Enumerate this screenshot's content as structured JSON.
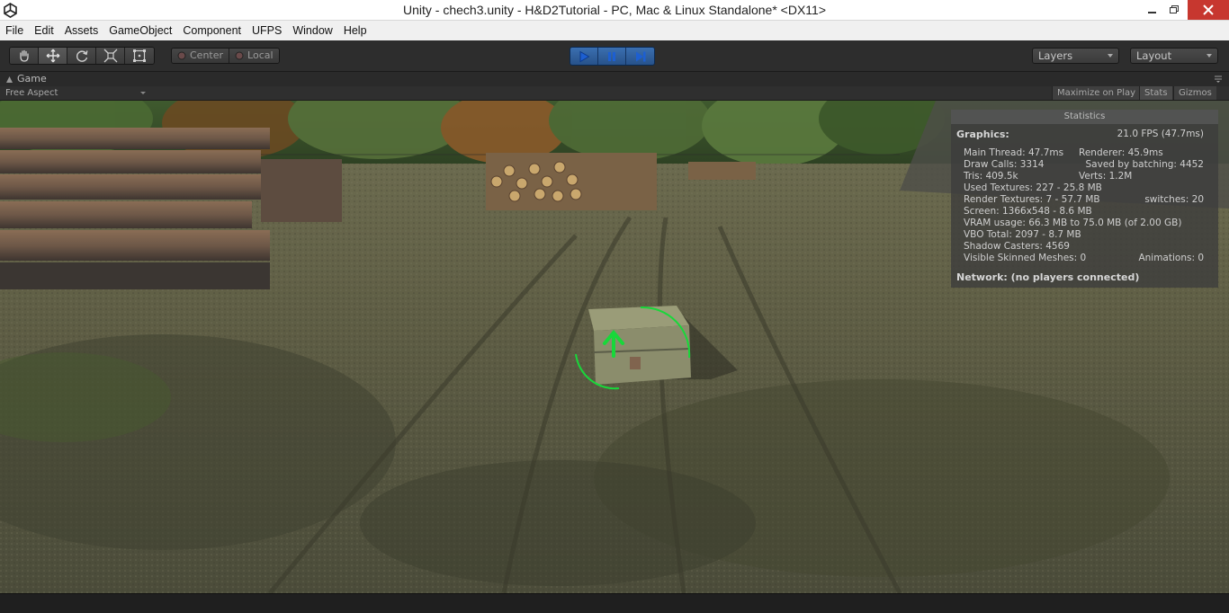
{
  "window": {
    "title": "Unity - chech3.unity - H&D2Tutorial - PC, Mac & Linux Standalone* <DX11>",
    "controls": [
      "minimize",
      "maximize",
      "close"
    ]
  },
  "menu": {
    "items": [
      "File",
      "Edit",
      "Assets",
      "GameObject",
      "Component",
      "UFPS",
      "Window",
      "Help"
    ]
  },
  "toolbar": {
    "transform_tools": [
      "hand-icon",
      "move-icon",
      "rotate-icon",
      "scale-icon",
      "rect-icon"
    ],
    "pivot_center": "Center",
    "pivot_local": "Local",
    "play_controls": [
      "play-icon",
      "pause-icon",
      "step-icon"
    ],
    "layers_label": "Layers",
    "layout_label": "Layout"
  },
  "game_tab": {
    "label": "Game",
    "aspect": "Free Aspect",
    "maximize_on_play": "Maximize on Play",
    "stats": "Stats",
    "gizmos": "Gizmos"
  },
  "statistics": {
    "header": "Statistics",
    "graphics_label": "Graphics:",
    "fps": "21.0 FPS (47.7ms)",
    "main_thread": "Main Thread: 47.7ms",
    "renderer": "Renderer: 45.9ms",
    "draw_calls": "Draw Calls: 3314",
    "saved_by_batching": "Saved by batching: 4452",
    "tris": "Tris: 409.5k",
    "verts": "Verts: 1.2M",
    "used_textures": "Used Textures: 227 - 25.8 MB",
    "render_textures": "Render Textures: 7 - 57.7 MB",
    "switches": "switches: 20",
    "screen": "Screen: 1366x548 - 8.6 MB",
    "vram_usage": "VRAM usage: 66.3 MB to 75.0 MB (of 2.00 GB)",
    "vbo_total": "VBO Total: 2097 - 8.7 MB",
    "shadow_casters": "Shadow Casters: 4569",
    "visible_skinned_meshes": "Visible Skinned Meshes: 0",
    "animations": "Animations: 0",
    "network": "Network: (no players connected)"
  },
  "colors": {
    "toolbar_bg": "#2d2d2d",
    "play_blue": "#2f62a3",
    "gizmo_green": "#18d83a",
    "close_red": "#c7372f"
  }
}
